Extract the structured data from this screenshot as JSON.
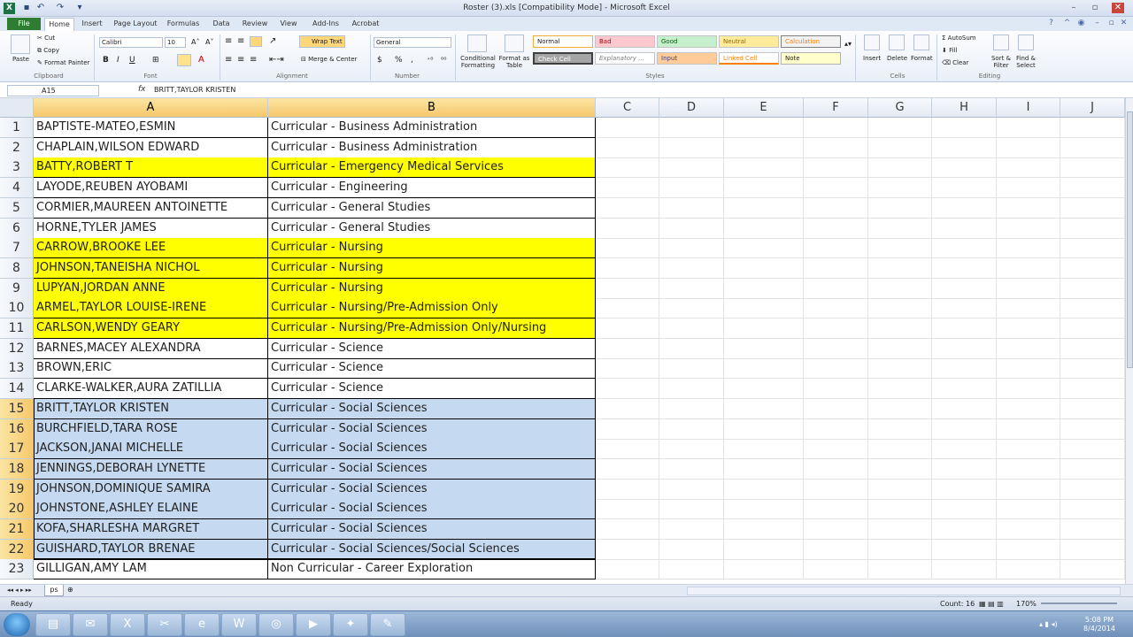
{
  "window": {
    "title": "Roster (3).xls  [Compatibility Mode] - Microsoft Excel",
    "qat_icons": [
      "save-icon",
      "undo-icon",
      "redo-icon"
    ]
  },
  "ribbon": {
    "file_label": "File",
    "tabs": [
      "Home",
      "Insert",
      "Page Layout",
      "Formulas",
      "Data",
      "Review",
      "View",
      "Add-Ins",
      "Acrobat"
    ],
    "active_tab": "Home",
    "clipboard": {
      "paste": "Paste",
      "cut": "Cut",
      "copy": "Copy",
      "format_painter": "Format Painter",
      "label": "Clipboard"
    },
    "font": {
      "name": "Calibri",
      "size": "10",
      "label": "Font"
    },
    "alignment": {
      "wrap": "Wrap Text",
      "merge": "Merge & Center",
      "label": "Alignment"
    },
    "number": {
      "format": "General",
      "label": "Number"
    },
    "styles": {
      "conditional": "Conditional Formatting",
      "format_table": "Format as Table",
      "normal": "Normal",
      "bad": "Bad",
      "good": "Good",
      "neutral": "Neutral",
      "calculation": "Calculation",
      "check_cell": "Check Cell",
      "explanatory": "Explanatory ...",
      "input": "Input",
      "linked_cell": "Linked Cell",
      "note": "Note",
      "label": "Styles"
    },
    "cells": {
      "insert": "Insert",
      "delete": "Delete",
      "format": "Format",
      "label": "Cells"
    },
    "editing": {
      "autosum": "AutoSum",
      "fill": "Fill",
      "clear": "Clear",
      "sort": "Sort & Filter",
      "find": "Find & Select",
      "label": "Editing"
    }
  },
  "formula_bar": {
    "name_box": "A15",
    "fx": "fx",
    "formula": "BRITT,TAYLOR KRISTEN"
  },
  "columns": [
    "A",
    "B",
    "C",
    "D",
    "E",
    "F",
    "G",
    "H",
    "I",
    "J"
  ],
  "rows": [
    {
      "n": "1",
      "a": "BAPTISTE-MATEO,ESMIN",
      "b": "Curricular - Business Administration",
      "style": "plain"
    },
    {
      "n": "2",
      "a": "CHAPLAIN,WILSON EDWARD",
      "b": "Curricular - Business Administration",
      "style": "plain"
    },
    {
      "n": "3",
      "a": "BATTY,ROBERT T",
      "b": "Curricular - Emergency Medical Services",
      "style": "yellow"
    },
    {
      "n": "4",
      "a": "LAYODE,REUBEN AYOBAMI",
      "b": "Curricular - Engineering",
      "style": "plain"
    },
    {
      "n": "5",
      "a": "CORMIER,MAUREEN ANTOINETTE",
      "b": "Curricular - General Studies",
      "style": "plain"
    },
    {
      "n": "6",
      "a": "HORNE,TYLER JAMES",
      "b": "Curricular - General Studies",
      "style": "plain"
    },
    {
      "n": "7",
      "a": "CARROW,BROOKE LEE",
      "b": "Curricular - Nursing",
      "style": "yellow"
    },
    {
      "n": "8",
      "a": "JOHNSON,TANEISHA NICHOL",
      "b": "Curricular - Nursing",
      "style": "yellow"
    },
    {
      "n": "9",
      "a": "LUPYAN,JORDAN ANNE",
      "b": "Curricular - Nursing",
      "style": "yellow"
    },
    {
      "n": "10",
      "a": "ARMEL,TAYLOR LOUISE-IRENE",
      "b": "Curricular - Nursing/Pre-Admission Only",
      "style": "yellow"
    },
    {
      "n": "11",
      "a": "CARLSON,WENDY GEARY",
      "b": "Curricular - Nursing/Pre-Admission Only/Nursing",
      "style": "yellow"
    },
    {
      "n": "12",
      "a": "BARNES,MACEY ALEXANDRA",
      "b": "Curricular - Science",
      "style": "plain"
    },
    {
      "n": "13",
      "a": "BROWN,ERIC",
      "b": "Curricular - Science",
      "style": "plain"
    },
    {
      "n": "14",
      "a": "CLARKE-WALKER,AURA ZATILLIA",
      "b": "Curricular - Science",
      "style": "plain"
    },
    {
      "n": "15",
      "a": "BRITT,TAYLOR KRISTEN",
      "b": "Curricular - Social Sciences",
      "style": "selected"
    },
    {
      "n": "16",
      "a": "BURCHFIELD,TARA ROSE",
      "b": "Curricular - Social Sciences",
      "style": "selected"
    },
    {
      "n": "17",
      "a": "JACKSON,JANAI MICHELLE",
      "b": "Curricular - Social Sciences",
      "style": "selected"
    },
    {
      "n": "18",
      "a": "JENNINGS,DEBORAH LYNETTE",
      "b": "Curricular - Social Sciences",
      "style": "selected"
    },
    {
      "n": "19",
      "a": "JOHNSON,DOMINIQUE SAMIRA",
      "b": "Curricular - Social Sciences",
      "style": "selected"
    },
    {
      "n": "20",
      "a": "JOHNSTONE,ASHLEY ELAINE",
      "b": "Curricular - Social Sciences",
      "style": "selected"
    },
    {
      "n": "21",
      "a": "KOFA,SHARLESHA MARGRET",
      "b": "Curricular - Social Sciences",
      "style": "selected"
    },
    {
      "n": "22",
      "a": "GUISHARD,TAYLOR BRENAE",
      "b": "Curricular - Social Sciences/Social Sciences",
      "style": "selected"
    },
    {
      "n": "23",
      "a": "GILLIGAN,AMY LAM",
      "b": "Non Curricular - Career Exploration",
      "style": "plain"
    }
  ],
  "sheet_tabs": [
    "ps"
  ],
  "status": {
    "ready": "Ready",
    "count": "Count: 16",
    "zoom": "170%"
  },
  "taskbar": {
    "apps": [
      "explorer-icon",
      "outlook-icon",
      "excel-icon",
      "snipping-icon",
      "ie-icon",
      "word-icon",
      "chrome-icon",
      "media-icon",
      "acrobat-icon",
      "paint-icon"
    ],
    "time": "5:08 PM",
    "date": "8/4/2014"
  },
  "colors": {
    "yellow": "#ffff00",
    "selection": "#c5d9f1",
    "header_selected": "#f6c86b",
    "file_tab": "#2e7d32"
  }
}
